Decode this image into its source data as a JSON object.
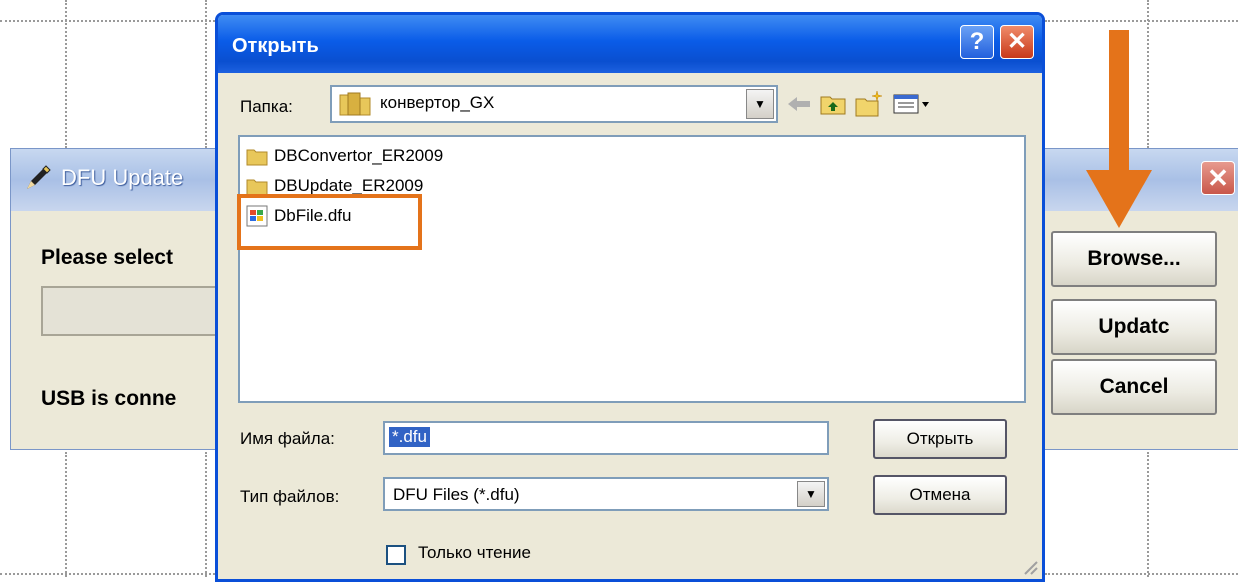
{
  "dfu_window": {
    "title": "DFU Update",
    "select_label": "Please select",
    "usb_label": "USB is conne",
    "close_glyph": "✕",
    "buttons": {
      "browse": "Browse...",
      "update": "Updatc",
      "cancel": "Cancel"
    }
  },
  "open_dialog": {
    "title": "Открыть",
    "help_glyph": "?",
    "close_glyph": "✕",
    "folder_label": "Папка:",
    "current_folder": "конвертор_GX",
    "files": [
      {
        "name": "DBConvertor_ER2009",
        "type": "folder"
      },
      {
        "name": "DBUpdate_ER2009",
        "type": "folder"
      },
      {
        "name": "DbFile.dfu",
        "type": "file"
      }
    ],
    "filename_label": "Имя файла:",
    "filename_value": "*.dfu",
    "filetype_label": "Тип файлов:",
    "filetype_value": "DFU Files (*.dfu)",
    "open_button": "Открыть",
    "cancel_button": "Отмена",
    "readonly_label": "Только чтение",
    "readonly_checked": false
  },
  "colors": {
    "highlight": "#e4731a",
    "arrow": "#e4731a",
    "title_bar": "#0a5ce8"
  }
}
